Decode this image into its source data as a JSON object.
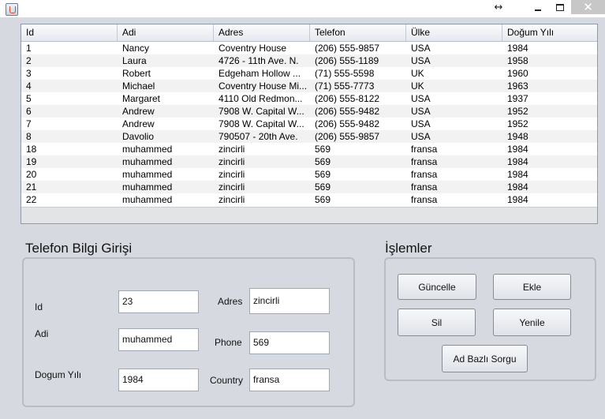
{
  "titlebar": {
    "resize_glyph": "↔",
    "close_glyph": "✕",
    "icons": [
      "java-app-icon",
      "resize-icon",
      "minimize-icon",
      "maximize-icon",
      "close-icon"
    ]
  },
  "table": {
    "columns": [
      "Id",
      "Adi",
      "Adres",
      "Telefon",
      "Ülke",
      "Doğum Yılı"
    ],
    "rows": [
      [
        "1",
        "Nancy",
        "Coventry House",
        "(206) 555-9857",
        "USA",
        "1984"
      ],
      [
        "2",
        "Laura",
        "4726 - 11th Ave. N.",
        "(206) 555-1189",
        "USA",
        "1958"
      ],
      [
        "3",
        "Robert",
        "Edgeham Hollow ...",
        "(71) 555-5598",
        "UK",
        "1960"
      ],
      [
        "4",
        "Michael",
        "Coventry House Mi...",
        "(71) 555-7773",
        "UK",
        "1963"
      ],
      [
        "5",
        "Margaret",
        "4110 Old Redmon...",
        "(206) 555-8122",
        "USA",
        "1937"
      ],
      [
        "6",
        "Andrew",
        "7908 W. Capital W...",
        "(206) 555-9482",
        "USA",
        "1952"
      ],
      [
        "7",
        "Andrew",
        "7908 W. Capital W...",
        "(206) 555-9482",
        "USA",
        "1952"
      ],
      [
        "8",
        "Davolio",
        "790507 - 20th Ave.",
        "(206) 555-9857",
        "USA",
        "1948"
      ],
      [
        "18",
        "muhammed",
        "zincirli",
        "569",
        "fransa",
        "1984"
      ],
      [
        "19",
        "muhammed",
        "zincirli",
        "569",
        "fransa",
        "1984"
      ],
      [
        "20",
        "muhammed",
        "zincirli",
        "569",
        "fransa",
        "1984"
      ],
      [
        "21",
        "muhammed",
        "zincirli",
        "569",
        "fransa",
        "1984"
      ],
      [
        "22",
        "muhammed",
        "zincirli",
        "569",
        "fransa",
        "1984"
      ]
    ]
  },
  "form": {
    "title": "Telefon Bilgi Girişi",
    "id_label": "Id",
    "id_value": "23",
    "adi_label": "Adi",
    "adi_value": "muhammed",
    "dogum_label": "Dogum Yılı",
    "dogum_value": "1984",
    "adres_label": "Adres",
    "adres_value": "zincirli",
    "phone_label": "Phone",
    "phone_value": "569",
    "country_label": "Country",
    "country_value": "fransa"
  },
  "actions": {
    "title": "İşlemler",
    "guncelle": "Güncelle",
    "ekle": "Ekle",
    "sil": "Sil",
    "yenile": "Yenile",
    "sorgu": "Ad Bazlı Sorgu"
  }
}
